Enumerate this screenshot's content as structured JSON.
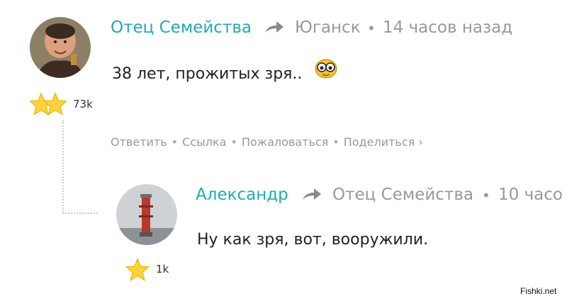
{
  "comment1": {
    "author": "Отец Семейства",
    "location": "Юганск",
    "time": "14 часов назад",
    "text": "38 лет, прожитых зря..",
    "emoji": "nerd-glasses-emoji",
    "rating": "73k"
  },
  "actions": {
    "reply": "Ответить",
    "link": "Ссылка",
    "report": "Пожаловаться",
    "share": "Поделиться ›"
  },
  "comment2": {
    "author": "Александр",
    "reply_to": "Отец Семейства",
    "time": "10 часо",
    "text": "Ну как зря, вот, вооружили.",
    "rating": "1k"
  },
  "watermark": "Fishki.net",
  "colors": {
    "author": "#20a9b5",
    "meta": "#999999",
    "star": "#ffd23c"
  }
}
